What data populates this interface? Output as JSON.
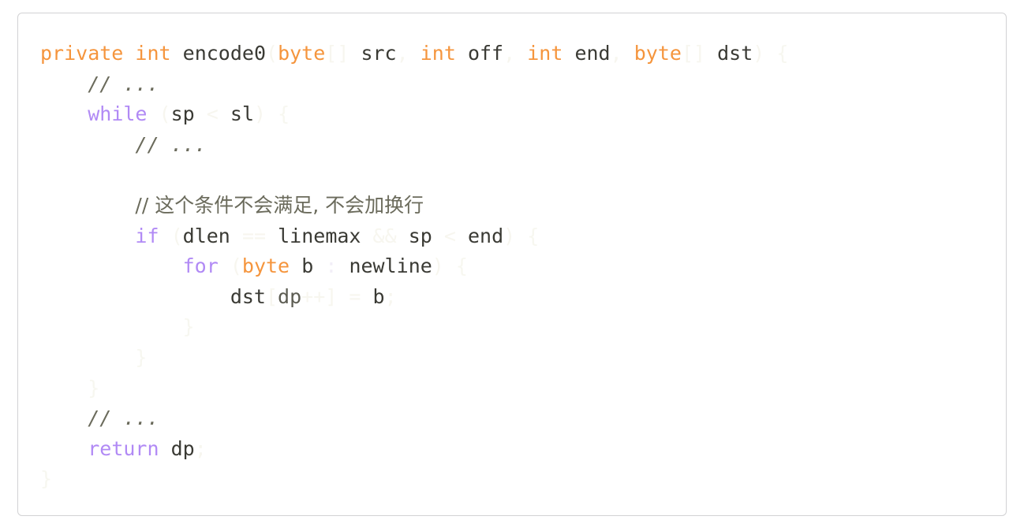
{
  "card": {
    "border_color": "#d2d2d4",
    "background": "#ffffff"
  },
  "theme": {
    "keyword_type_color": "#f5953d",
    "keyword_control_color": "#b18af5",
    "identifier_color": "#3a3a34",
    "comment_color": "#6b6b5c",
    "faded_punctuation_color": "#f7f6ef",
    "page_background": "#ffffff"
  },
  "code": {
    "language": "java",
    "full_text": "private int encode0(byte[] src, int off, int end, byte[] dst) {\n    // ...\n    while (sp < sl) {\n        // ...\n\n        // 这个条件不会满足, 不会加换行\n        if (dlen == linemax && sp < end) {\n            for (byte b : newline) {\n                dst[dp++] = b;\n            }\n        }\n    }\n    // ...\n    return dp;\n}",
    "lines": [
      {
        "indent": 0,
        "tokens": [
          {
            "t": "private",
            "c": "kw"
          },
          {
            "t": " ",
            "c": "ws"
          },
          {
            "t": "int",
            "c": "kw"
          },
          {
            "t": " ",
            "c": "ws"
          },
          {
            "t": "encode0",
            "c": "ident"
          },
          {
            "t": "(",
            "c": "pun"
          },
          {
            "t": "byte",
            "c": "kw"
          },
          {
            "t": "[]",
            "c": "pun"
          },
          {
            "t": " ",
            "c": "ws"
          },
          {
            "t": "src",
            "c": "ident"
          },
          {
            "t": ",",
            "c": "pun"
          },
          {
            "t": " ",
            "c": "ws"
          },
          {
            "t": "int",
            "c": "kw"
          },
          {
            "t": " ",
            "c": "ws"
          },
          {
            "t": "off",
            "c": "ident"
          },
          {
            "t": ",",
            "c": "pun"
          },
          {
            "t": " ",
            "c": "ws"
          },
          {
            "t": "int",
            "c": "kw"
          },
          {
            "t": " ",
            "c": "ws"
          },
          {
            "t": "end",
            "c": "ident"
          },
          {
            "t": ",",
            "c": "pun"
          },
          {
            "t": " ",
            "c": "ws"
          },
          {
            "t": "byte",
            "c": "kw"
          },
          {
            "t": "[]",
            "c": "pun"
          },
          {
            "t": " ",
            "c": "ws"
          },
          {
            "t": "dst",
            "c": "ident"
          },
          {
            "t": ")",
            "c": "pun"
          },
          {
            "t": " ",
            "c": "ws"
          },
          {
            "t": "{",
            "c": "brace"
          }
        ]
      },
      {
        "indent": 4,
        "tokens": [
          {
            "t": "// ...",
            "c": "cmt"
          }
        ]
      },
      {
        "indent": 4,
        "tokens": [
          {
            "t": "while",
            "c": "kw2"
          },
          {
            "t": " ",
            "c": "ws"
          },
          {
            "t": "(",
            "c": "pun"
          },
          {
            "t": "sp",
            "c": "ident"
          },
          {
            "t": " ",
            "c": "ws"
          },
          {
            "t": "<",
            "c": "pun"
          },
          {
            "t": " ",
            "c": "ws"
          },
          {
            "t": "sl",
            "c": "ident"
          },
          {
            "t": ")",
            "c": "pun"
          },
          {
            "t": " ",
            "c": "ws"
          },
          {
            "t": "{",
            "c": "brace"
          }
        ]
      },
      {
        "indent": 8,
        "tokens": [
          {
            "t": "// ...",
            "c": "cmt"
          }
        ]
      },
      {
        "indent": 0,
        "tokens": []
      },
      {
        "indent": 8,
        "tokens": [
          {
            "t": "// 这个条件不会满足, 不会加换行",
            "c": "cmt-cn"
          }
        ]
      },
      {
        "indent": 8,
        "tokens": [
          {
            "t": "if",
            "c": "kw2"
          },
          {
            "t": " ",
            "c": "ws"
          },
          {
            "t": "(",
            "c": "pun"
          },
          {
            "t": "dlen",
            "c": "ident"
          },
          {
            "t": " ",
            "c": "ws"
          },
          {
            "t": "==",
            "c": "pun"
          },
          {
            "t": " ",
            "c": "ws"
          },
          {
            "t": "linemax",
            "c": "ident"
          },
          {
            "t": " ",
            "c": "ws"
          },
          {
            "t": "&&",
            "c": "pun"
          },
          {
            "t": " ",
            "c": "ws"
          },
          {
            "t": "sp",
            "c": "ident"
          },
          {
            "t": " ",
            "c": "ws"
          },
          {
            "t": "<",
            "c": "pun"
          },
          {
            "t": " ",
            "c": "ws"
          },
          {
            "t": "end",
            "c": "ident"
          },
          {
            "t": ")",
            "c": "pun"
          },
          {
            "t": " ",
            "c": "ws"
          },
          {
            "t": "{",
            "c": "brace"
          }
        ]
      },
      {
        "indent": 12,
        "tokens": [
          {
            "t": "for",
            "c": "kw2"
          },
          {
            "t": " ",
            "c": "ws"
          },
          {
            "t": "(",
            "c": "pun"
          },
          {
            "t": "byte",
            "c": "kw"
          },
          {
            "t": " ",
            "c": "ws"
          },
          {
            "t": "b",
            "c": "ident"
          },
          {
            "t": " ",
            "c": "ws"
          },
          {
            "t": ":",
            "c": "pun2"
          },
          {
            "t": " ",
            "c": "ws"
          },
          {
            "t": "newline",
            "c": "ident"
          },
          {
            "t": ")",
            "c": "pun"
          },
          {
            "t": " ",
            "c": "ws"
          },
          {
            "t": "{",
            "c": "brace"
          }
        ]
      },
      {
        "indent": 16,
        "tokens": [
          {
            "t": "dst",
            "c": "ident"
          },
          {
            "t": "[",
            "c": "pun"
          },
          {
            "t": "dp",
            "c": "ident-d"
          },
          {
            "t": "++",
            "c": "pun"
          },
          {
            "t": "]",
            "c": "pun"
          },
          {
            "t": " ",
            "c": "ws"
          },
          {
            "t": "=",
            "c": "pun"
          },
          {
            "t": " ",
            "c": "ws"
          },
          {
            "t": "b",
            "c": "ident"
          },
          {
            "t": ";",
            "c": "pun"
          }
        ]
      },
      {
        "indent": 12,
        "tokens": [
          {
            "t": "}",
            "c": "brace"
          }
        ]
      },
      {
        "indent": 8,
        "tokens": [
          {
            "t": "}",
            "c": "brace"
          }
        ]
      },
      {
        "indent": 4,
        "tokens": [
          {
            "t": "}",
            "c": "brace"
          }
        ]
      },
      {
        "indent": 4,
        "tokens": [
          {
            "t": "// ...",
            "c": "cmt"
          }
        ]
      },
      {
        "indent": 4,
        "tokens": [
          {
            "t": "return",
            "c": "kw2"
          },
          {
            "t": " ",
            "c": "ws"
          },
          {
            "t": "dp",
            "c": "ident"
          },
          {
            "t": ";",
            "c": "pun"
          }
        ]
      },
      {
        "indent": 0,
        "tokens": [
          {
            "t": "}",
            "c": "brace"
          }
        ]
      }
    ]
  }
}
